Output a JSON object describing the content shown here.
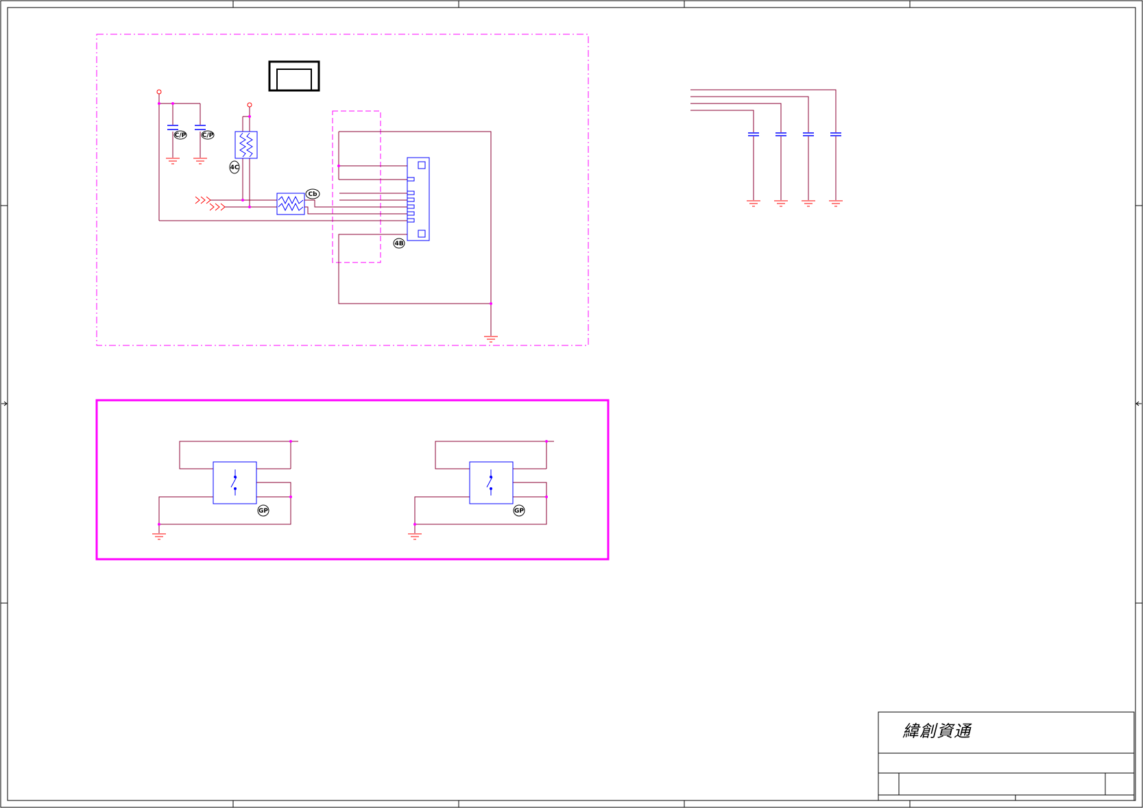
{
  "title_block": {
    "company_name": "緯創資通"
  },
  "component_badges": {
    "connector": "4B",
    "ferrite": "Cb",
    "resistor": "4C",
    "cap_left": "C/P",
    "cap_right": "C/P",
    "switch_left": "GP",
    "switch_right": "GP"
  },
  "colors": {
    "wire": "#8b0033",
    "net_red": "#ff0000",
    "junction": "#ff00ff",
    "part_outline": "#0000ff",
    "group_box": "#ff00ff",
    "border": "#000000"
  }
}
